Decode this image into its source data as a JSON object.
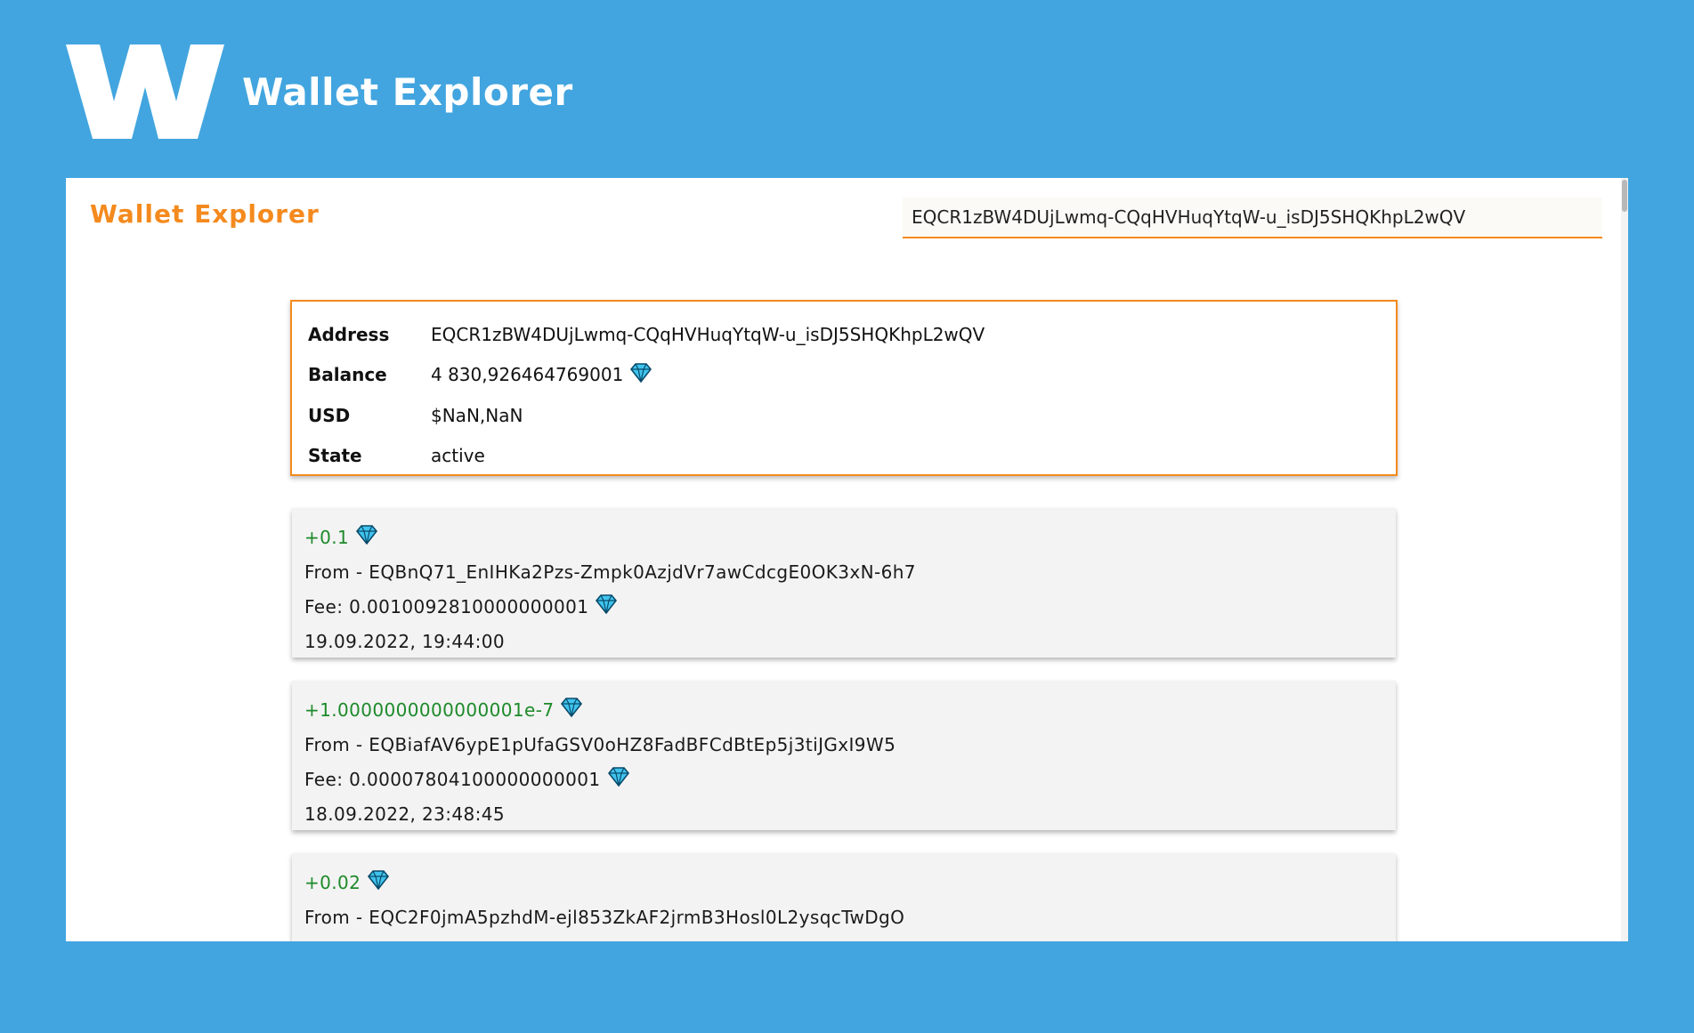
{
  "brand": {
    "logo_letter": "W",
    "title": "Wallet Explorer"
  },
  "app": {
    "title": "Wallet Explorer"
  },
  "search": {
    "value": "EQCR1zBW4DUjLwmq-CQqHVHuqYtqW-u_isDJ5SHQKhpL2wQV"
  },
  "wallet": {
    "address_label": "Address",
    "address": "EQCR1zBW4DUjLwmq-CQqHVHuqYtqW-u_isDJ5SHQKhpL2wQV",
    "balance_label": "Balance",
    "balance": "4 830,926464769001",
    "usd_label": "USD",
    "usd": "$NaN,NaN",
    "state_label": "State",
    "state": "active"
  },
  "transactions": [
    {
      "amount": "+0.1",
      "from": "From - EQBnQ71_EnIHKa2Pzs-Zmpk0AzjdVr7awCdcgE0OK3xN-6h7",
      "fee": "Fee: 0.0010092810000000001",
      "date": "19.09.2022, 19:44:00"
    },
    {
      "amount": "+1.0000000000000001e-7",
      "from": "From - EQBiafAV6ypE1pUfaGSV0oHZ8FadBFCdBtEp5j3tiJGxI9W5",
      "fee": "Fee: 0.00007804100000000001",
      "date": "18.09.2022, 23:48:45"
    },
    {
      "amount": "+0.02",
      "from": "From - EQC2F0jmA5pzhdM-ejl853ZkAF2jrmB3Hosl0L2ysqcTwDgO",
      "fee": "",
      "date": ""
    }
  ],
  "icons": {
    "currency": "gem-icon",
    "logo": "w-logo-icon"
  },
  "colors": {
    "background": "#42a5df",
    "accent": "#f48a1e",
    "positive": "#1d8a2a",
    "card": "#f3f3f3"
  }
}
